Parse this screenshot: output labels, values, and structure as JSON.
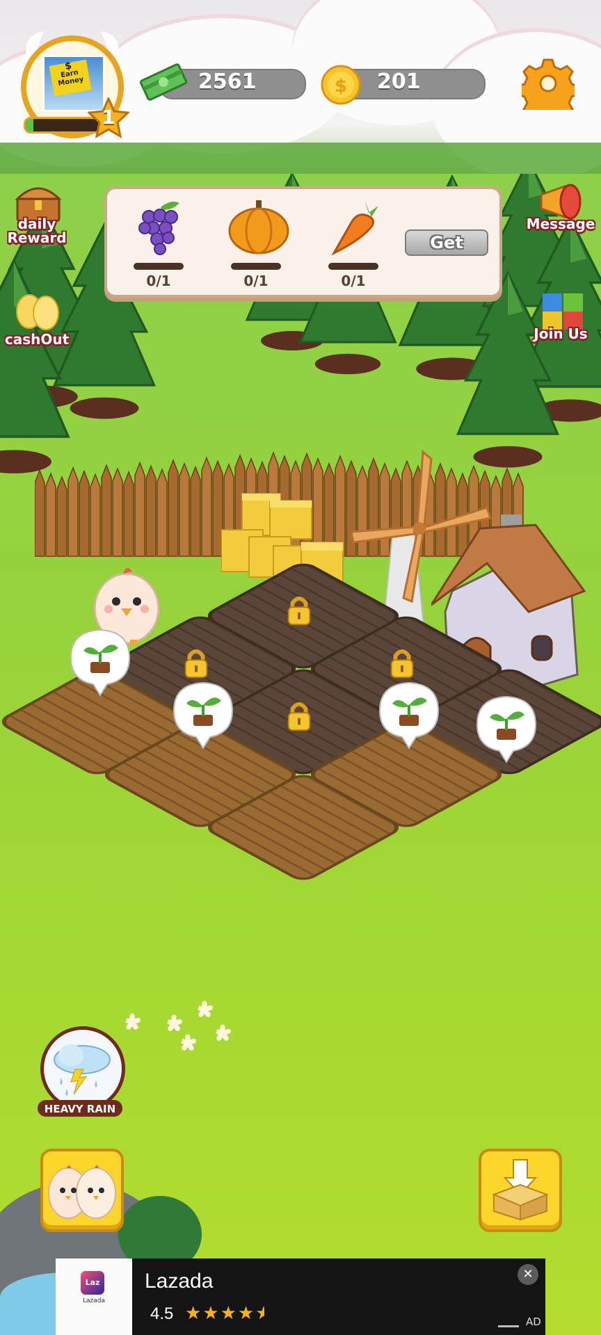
{
  "profile": {
    "level": "1",
    "avatar_text_top": "$",
    "avatar_text": "Earn Money",
    "xp_fraction": 0.1
  },
  "currency": {
    "cash": "2561",
    "coins": "201"
  },
  "side_left": {
    "daily_reward": [
      "daily",
      "Reward"
    ],
    "cashout": "cashOut"
  },
  "side_right": {
    "message": "Message",
    "join_us": "Join Us"
  },
  "order_panel": {
    "items": [
      {
        "name": "grapes-icon",
        "count": "0/1"
      },
      {
        "name": "pumpkin-icon",
        "count": "0/1"
      },
      {
        "name": "carrot-icon",
        "count": "0/1"
      }
    ],
    "get_label": "Get"
  },
  "weather": {
    "label": "HEAVY RAIN"
  },
  "ad": {
    "logo_text": "Laz",
    "logo_sub": "Lazada",
    "title": "Lazada",
    "rating": "4.5",
    "rating_value": 4.5,
    "badge": "AD"
  },
  "colors": {
    "gold": "#f4b41a",
    "brand_ad": "#0f146d",
    "grass": "#8ccd3f"
  }
}
